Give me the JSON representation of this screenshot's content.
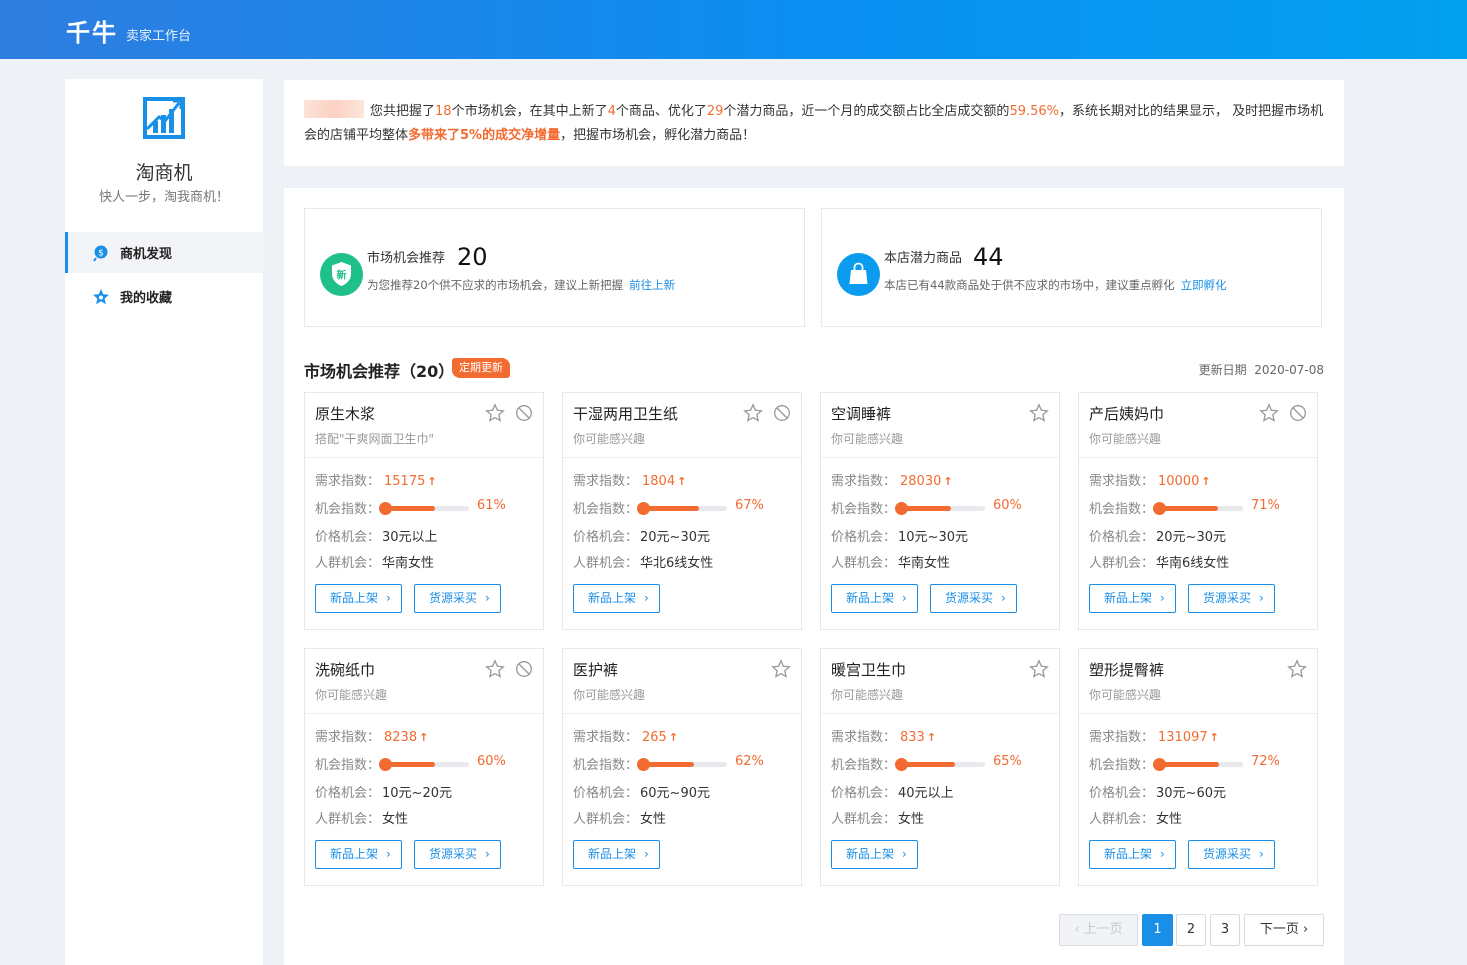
{
  "header": {
    "brand": "千牛",
    "subtitle": "卖家工作台"
  },
  "sidebar": {
    "app_title": "淘商机",
    "slogan": "快人一步，淘我商机！",
    "items": [
      {
        "label": "商机发现",
        "icon": "bulb-search-icon",
        "active": true
      },
      {
        "label": "我的收藏",
        "icon": "star-badge-icon",
        "active": false
      }
    ]
  },
  "summary": {
    "p1": "您共把握了",
    "n_opps": "18",
    "p2": "个市场机会，在其中上新了",
    "n_new": "4",
    "p3": "个商品、优化了",
    "n_opt": "29",
    "p4": "个潜力商品，近一个月的成交额占比全店成交额的",
    "ratio": "59.56%",
    "p5": "，系统长期对比的结果显示，  及时把握市场机会的店铺平均整体",
    "boost": "多带来了5%的成交净增量",
    "p6": "，把握市场机会，孵化潜力商品！"
  },
  "stats": [
    {
      "title": "市场机会推荐",
      "number": "20",
      "desc": "为您推荐20个供不应求的市场机会，建议上新把握",
      "link": "前往上新",
      "icon": "shield-new-icon",
      "icon_text": "新",
      "color": "#1fc08b"
    },
    {
      "title": "本店潜力商品",
      "number": "44",
      "desc": "本店已有44款商品处于供不应求的市场中，建议重点孵化",
      "link": "立即孵化",
      "icon": "shopping-bag-icon",
      "color": "#0b9cf0"
    }
  ],
  "section": {
    "title": "市场机会推荐（20）",
    "badge": "定期更新",
    "update_label": "更新日期",
    "update_date": "2020-07-08"
  },
  "labels": {
    "demand": "需求指数：",
    "chance": "机会指数：",
    "price": "价格机会：",
    "crowd": "人群机会：",
    "btn_new": "新品上架",
    "btn_source": "货源采买",
    "arrow": "↑",
    "chev": "›"
  },
  "cards": [
    {
      "name": "原生木浆",
      "sub": "搭配\"干爽网面卫生巾\"",
      "demand": "15175",
      "chance": 61,
      "chance_text": "61%",
      "price": "30元以上",
      "crowd": "华南女性",
      "ban": true,
      "source": true
    },
    {
      "name": "干湿两用卫生纸",
      "sub": "你可能感兴趣",
      "demand": "1804",
      "chance": 67,
      "chance_text": "67%",
      "price": "20元~30元",
      "crowd": "华北6线女性",
      "ban": true,
      "source": false
    },
    {
      "name": "空调睡裤",
      "sub": "你可能感兴趣",
      "demand": "28030",
      "chance": 60,
      "chance_text": "60%",
      "price": "10元~30元",
      "crowd": "华南女性",
      "ban": false,
      "source": true
    },
    {
      "name": "产后姨妈巾",
      "sub": "你可能感兴趣",
      "demand": "10000",
      "chance": 71,
      "chance_text": "71%",
      "price": "20元~30元",
      "crowd": "华南6线女性",
      "ban": true,
      "source": true
    },
    {
      "name": "洗碗纸巾",
      "sub": "你可能感兴趣",
      "demand": "8238",
      "chance": 60,
      "chance_text": "60%",
      "price": "10元~20元",
      "crowd": "女性",
      "ban": true,
      "source": true
    },
    {
      "name": "医护裤",
      "sub": "你可能感兴趣",
      "demand": "265",
      "chance": 62,
      "chance_text": "62%",
      "price": "60元~90元",
      "crowd": "女性",
      "ban": false,
      "source": false
    },
    {
      "name": "暖宫卫生巾",
      "sub": "你可能感兴趣",
      "demand": "833",
      "chance": 65,
      "chance_text": "65%",
      "price": "40元以上",
      "crowd": "女性",
      "ban": false,
      "source": false
    },
    {
      "name": "塑形提臀裤",
      "sub": "你可能感兴趣",
      "demand": "131097",
      "chance": 72,
      "chance_text": "72%",
      "price": "30元~60元",
      "crowd": "女性",
      "ban": false,
      "source": true
    }
  ],
  "pagination": {
    "prev": "‹ 上一页",
    "pages": [
      "1",
      "2",
      "3"
    ],
    "current": "1",
    "next": "下一页 ›"
  }
}
